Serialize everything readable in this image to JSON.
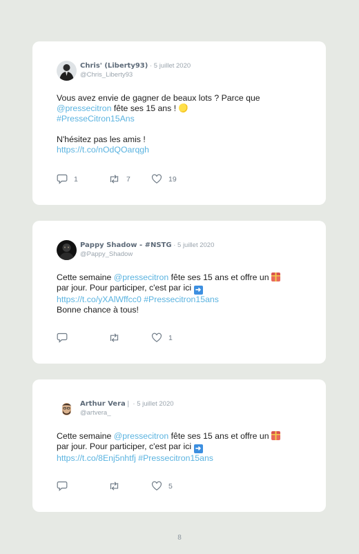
{
  "tweets": [
    {
      "display_name": "Chris' (Liberty93)",
      "separator": " · ",
      "date": "5 juillet 2020",
      "handle": "@Chris_Liberty93",
      "text": {
        "l1": "Vous avez envie de gagner de beaux lots ? Parce que",
        "mention": "@pressecitron",
        "l2b": " fête ses 15 ans ! ",
        "hashtag": "#PresseCitron15Ans",
        "l4": "N'hésitez pas les amis !",
        "url": "https://t.co/nOdQOarqgh"
      },
      "emoji": "lemon-emoji",
      "replies": "1",
      "retweets": "7",
      "likes": "19"
    },
    {
      "display_name": "Pappy Shadow - #NSTG",
      "separator": " · ",
      "date": "5 juillet 2020",
      "handle": "@Pappy_Shadow",
      "text": {
        "a": "Cette semaine ",
        "mention": "@pressecitron",
        "b": " fête ses 15 ans et offre un ",
        "c": "par jour. Pour participer, c'est par ici ",
        "url": "https://t.co/yXAlWffcc0",
        "hashtag": "#Pressecitron15ans",
        "d": "Bonne chance à tous!"
      },
      "emojis": [
        "gift-emoji",
        "right-arrow-emoji"
      ],
      "replies": "",
      "retweets": "",
      "likes": "1"
    },
    {
      "display_name": "Arthur Vera",
      "name_suffix": "❘",
      "separator": " · ",
      "date": "5 juillet 2020",
      "handle": "@artvera_",
      "text": {
        "a": "Cette semaine ",
        "mention": "@pressecitron",
        "b": " fête ses 15 ans et offre un ",
        "c": "par jour. Pour participer, c'est par ici ",
        "url": "https://t.co/8Enj5nhtfj",
        "hashtag": "#Pressecitron15ans"
      },
      "emojis": [
        "gift-emoji",
        "right-arrow-emoji"
      ],
      "replies": "",
      "retweets": "",
      "likes": "5"
    }
  ],
  "page_number": "8",
  "colors": {
    "link": "#5ab3e0",
    "name": "#5d6a78",
    "meta": "#9aa4ad",
    "background": "#e6e9e4"
  }
}
